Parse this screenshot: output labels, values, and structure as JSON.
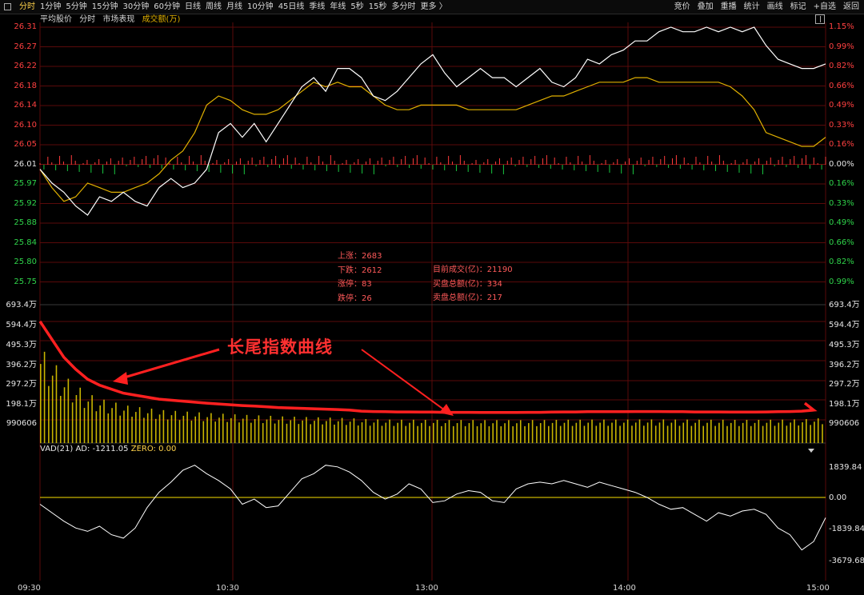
{
  "toolbar": {
    "tabs": [
      "分时",
      "1分钟",
      "5分钟",
      "15分钟",
      "30分钟",
      "60分钟",
      "日线",
      "周线",
      "月线",
      "10分钟",
      "45日线",
      "季线",
      "年线",
      "5秒",
      "15秒",
      "多分时",
      "更多 〉"
    ],
    "active_tab": "分时",
    "right_items": [
      "竞价",
      "叠加",
      "重播",
      "统计",
      "画线",
      "标记",
      "+自选",
      "返回"
    ]
  },
  "subbar": {
    "items": [
      "平均股价",
      "分时",
      "市场表现"
    ],
    "volume_label": "成交额(万)"
  },
  "price_axis": {
    "left_red": [
      "26.31",
      "26.27",
      "26.22",
      "26.18",
      "26.14",
      "26.10",
      "26.05"
    ],
    "left_white": "26.01",
    "left_green": [
      "25.97",
      "25.92",
      "25.88",
      "25.84",
      "25.80",
      "25.75"
    ],
    "right_red": [
      "1.15%",
      "0.99%",
      "0.82%",
      "0.66%",
      "0.49%",
      "0.33%",
      "0.16%"
    ],
    "right_white": "0.00%",
    "right_green": [
      "0.16%",
      "0.33%",
      "0.49%",
      "0.66%",
      "0.82%",
      "0.99%"
    ]
  },
  "volume_axis": {
    "labels": [
      "693.4万",
      "594.4万",
      "495.3万",
      "396.2万",
      "297.2万",
      "198.1万",
      "990606"
    ]
  },
  "market_stats": {
    "left": [
      "上涨：2683",
      "下跌：2612",
      "涨停：83",
      "跌停：26"
    ],
    "right": [
      "目前成交(亿)：21190",
      "买盘总额(亿)：334",
      "卖盘总额(亿)：217"
    ]
  },
  "vad": {
    "name": "VAD(21)",
    "ad": "AD: -1211.05",
    "zero": "ZERO: 0.00",
    "axis": [
      "1839.84",
      "0.00",
      "-1839.84",
      "-3679.68"
    ]
  },
  "time_axis": [
    "09:30",
    "10:30",
    "13:00",
    "14:00",
    "15:00"
  ],
  "annotation": {
    "text": "长尾指数曲线"
  },
  "colors": {
    "price_line": "#ffffff",
    "avg_line": "#e0b000",
    "up": "#ff3b3b",
    "down": "#18c840",
    "annotation": "#ff2020",
    "grid": "#5a0a0a"
  },
  "chart_data": {
    "type": "line",
    "time_x": [
      "09:30",
      "10:30",
      "13:00",
      "14:00",
      "15:00"
    ],
    "price": [
      26.0,
      25.97,
      25.95,
      25.92,
      25.9,
      25.94,
      25.93,
      25.95,
      25.93,
      25.92,
      25.96,
      25.98,
      25.96,
      25.97,
      26.0,
      26.08,
      26.1,
      26.07,
      26.1,
      26.06,
      26.1,
      26.14,
      26.18,
      26.2,
      26.17,
      26.22,
      26.22,
      26.2,
      26.16,
      26.15,
      26.17,
      26.2,
      26.23,
      26.25,
      26.21,
      26.18,
      26.2,
      26.22,
      26.2,
      26.2,
      26.18,
      26.2,
      26.22,
      26.19,
      26.18,
      26.2,
      26.24,
      26.23,
      26.25,
      26.26,
      26.28,
      26.28,
      26.3,
      26.31,
      26.3,
      26.3,
      26.31,
      26.3,
      26.31,
      26.3,
      26.31,
      26.27,
      26.24,
      26.23,
      26.22,
      26.22,
      26.23
    ],
    "avg_price": [
      26.0,
      25.96,
      25.93,
      25.94,
      25.97,
      25.96,
      25.95,
      25.95,
      25.96,
      25.97,
      25.99,
      26.02,
      26.04,
      26.08,
      26.14,
      26.16,
      26.15,
      26.13,
      26.12,
      26.12,
      26.13,
      26.15,
      26.17,
      26.19,
      26.18,
      26.19,
      26.18,
      26.18,
      26.16,
      26.14,
      26.13,
      26.13,
      26.14,
      26.14,
      26.14,
      26.14,
      26.13,
      26.13,
      26.13,
      26.13,
      26.13,
      26.14,
      26.15,
      26.16,
      26.16,
      26.17,
      26.18,
      26.19,
      26.19,
      26.19,
      26.2,
      26.2,
      26.19,
      26.19,
      26.19,
      26.19,
      26.19,
      26.19,
      26.18,
      26.16,
      26.13,
      26.08,
      26.07,
      26.06,
      26.05,
      26.05,
      26.07
    ],
    "volume_wan": [
      610,
      520,
      430,
      370,
      320,
      290,
      270,
      250,
      240,
      230,
      220,
      215,
      210,
      205,
      200,
      196,
      192,
      188,
      185,
      182,
      178,
      176,
      174,
      172,
      170,
      168,
      165,
      160,
      158,
      157,
      156,
      156,
      155,
      155,
      154,
      154,
      154,
      153,
      153,
      153,
      153,
      154,
      154,
      155,
      156,
      156,
      157,
      157,
      157,
      157,
      158,
      158,
      158,
      157,
      157,
      156,
      156,
      156,
      155,
      155,
      155,
      156,
      157,
      158,
      160,
      165,
      172
    ],
    "vad": [
      -400,
      -900,
      -1400,
      -1800,
      -2000,
      -1700,
      -2200,
      -2400,
      -1800,
      -600,
      300,
      900,
      1600,
      1900,
      1400,
      1000,
      500,
      -400,
      -100,
      -600,
      -500,
      300,
      1100,
      1400,
      1900,
      1800,
      1500,
      1000,
      300,
      -100,
      200,
      800,
      500,
      -300,
      -200,
      200,
      400,
      300,
      -200,
      -300,
      500,
      800,
      900,
      800,
      1000,
      800,
      600,
      900,
      700,
      500,
      300,
      0,
      -400,
      -700,
      -600,
      -1000,
      -1400,
      -900,
      -1100,
      -800,
      -700,
      -1000,
      -1800,
      -2200,
      -3100,
      -2600,
      -1200
    ],
    "price_range": [
      25.75,
      26.31
    ],
    "vad_range": [
      -3679.68,
      1839.84
    ]
  }
}
